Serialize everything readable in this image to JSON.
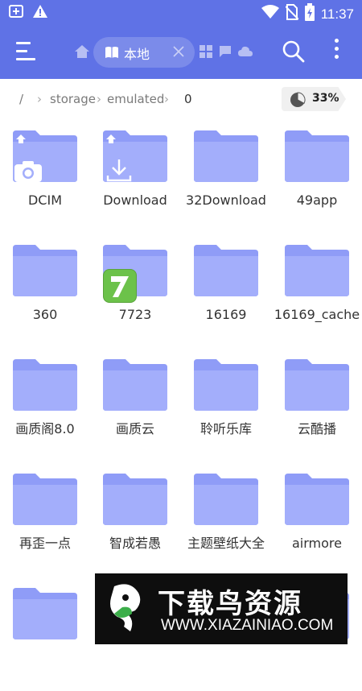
{
  "statusbar": {
    "time": "11:37",
    "icons": [
      "app-notification-icon",
      "warning-icon",
      "wifi-icon",
      "no-sim-icon",
      "battery-charging-icon"
    ]
  },
  "toolbar": {
    "tab_label": "本地",
    "extra_tab_icons": [
      "grid-icon",
      "message-icon",
      "cloud-icon"
    ]
  },
  "breadcrumb": {
    "root": "/",
    "items": [
      "storage",
      "emulated",
      "0"
    ],
    "storage_used": "33%",
    "storage_used_fraction": 0.33
  },
  "folders": [
    {
      "name": "DCIM",
      "badge": "camera"
    },
    {
      "name": "Download",
      "badge": "download"
    },
    {
      "name": "32Download",
      "badge": ""
    },
    {
      "name": "49app",
      "badge": ""
    },
    {
      "name": "360",
      "badge": ""
    },
    {
      "name": "7723",
      "badge": "app7723"
    },
    {
      "name": "16169",
      "badge": ""
    },
    {
      "name": "16169_cache",
      "badge": ""
    },
    {
      "name": "画质阁8.0",
      "badge": ""
    },
    {
      "name": "画质云",
      "badge": ""
    },
    {
      "name": "聆听乐库",
      "badge": ""
    },
    {
      "name": "云酷播",
      "badge": ""
    },
    {
      "name": "再歪一点",
      "badge": ""
    },
    {
      "name": "智成若愚",
      "badge": ""
    },
    {
      "name": "主题壁纸大全",
      "badge": ""
    },
    {
      "name": "airmore",
      "badge": ""
    },
    {
      "name": "",
      "badge": ""
    },
    {
      "name": "",
      "badge": ""
    },
    {
      "name": "",
      "badge": ""
    },
    {
      "name": "",
      "badge": ""
    }
  ],
  "colors": {
    "accent": "#5f72e6",
    "folder_back": "#8f9cf7",
    "folder_front": "#a3aefb"
  },
  "watermark": {
    "title": "下载鸟资源",
    "url": "WWW.XIAZAINIAO.COM"
  }
}
